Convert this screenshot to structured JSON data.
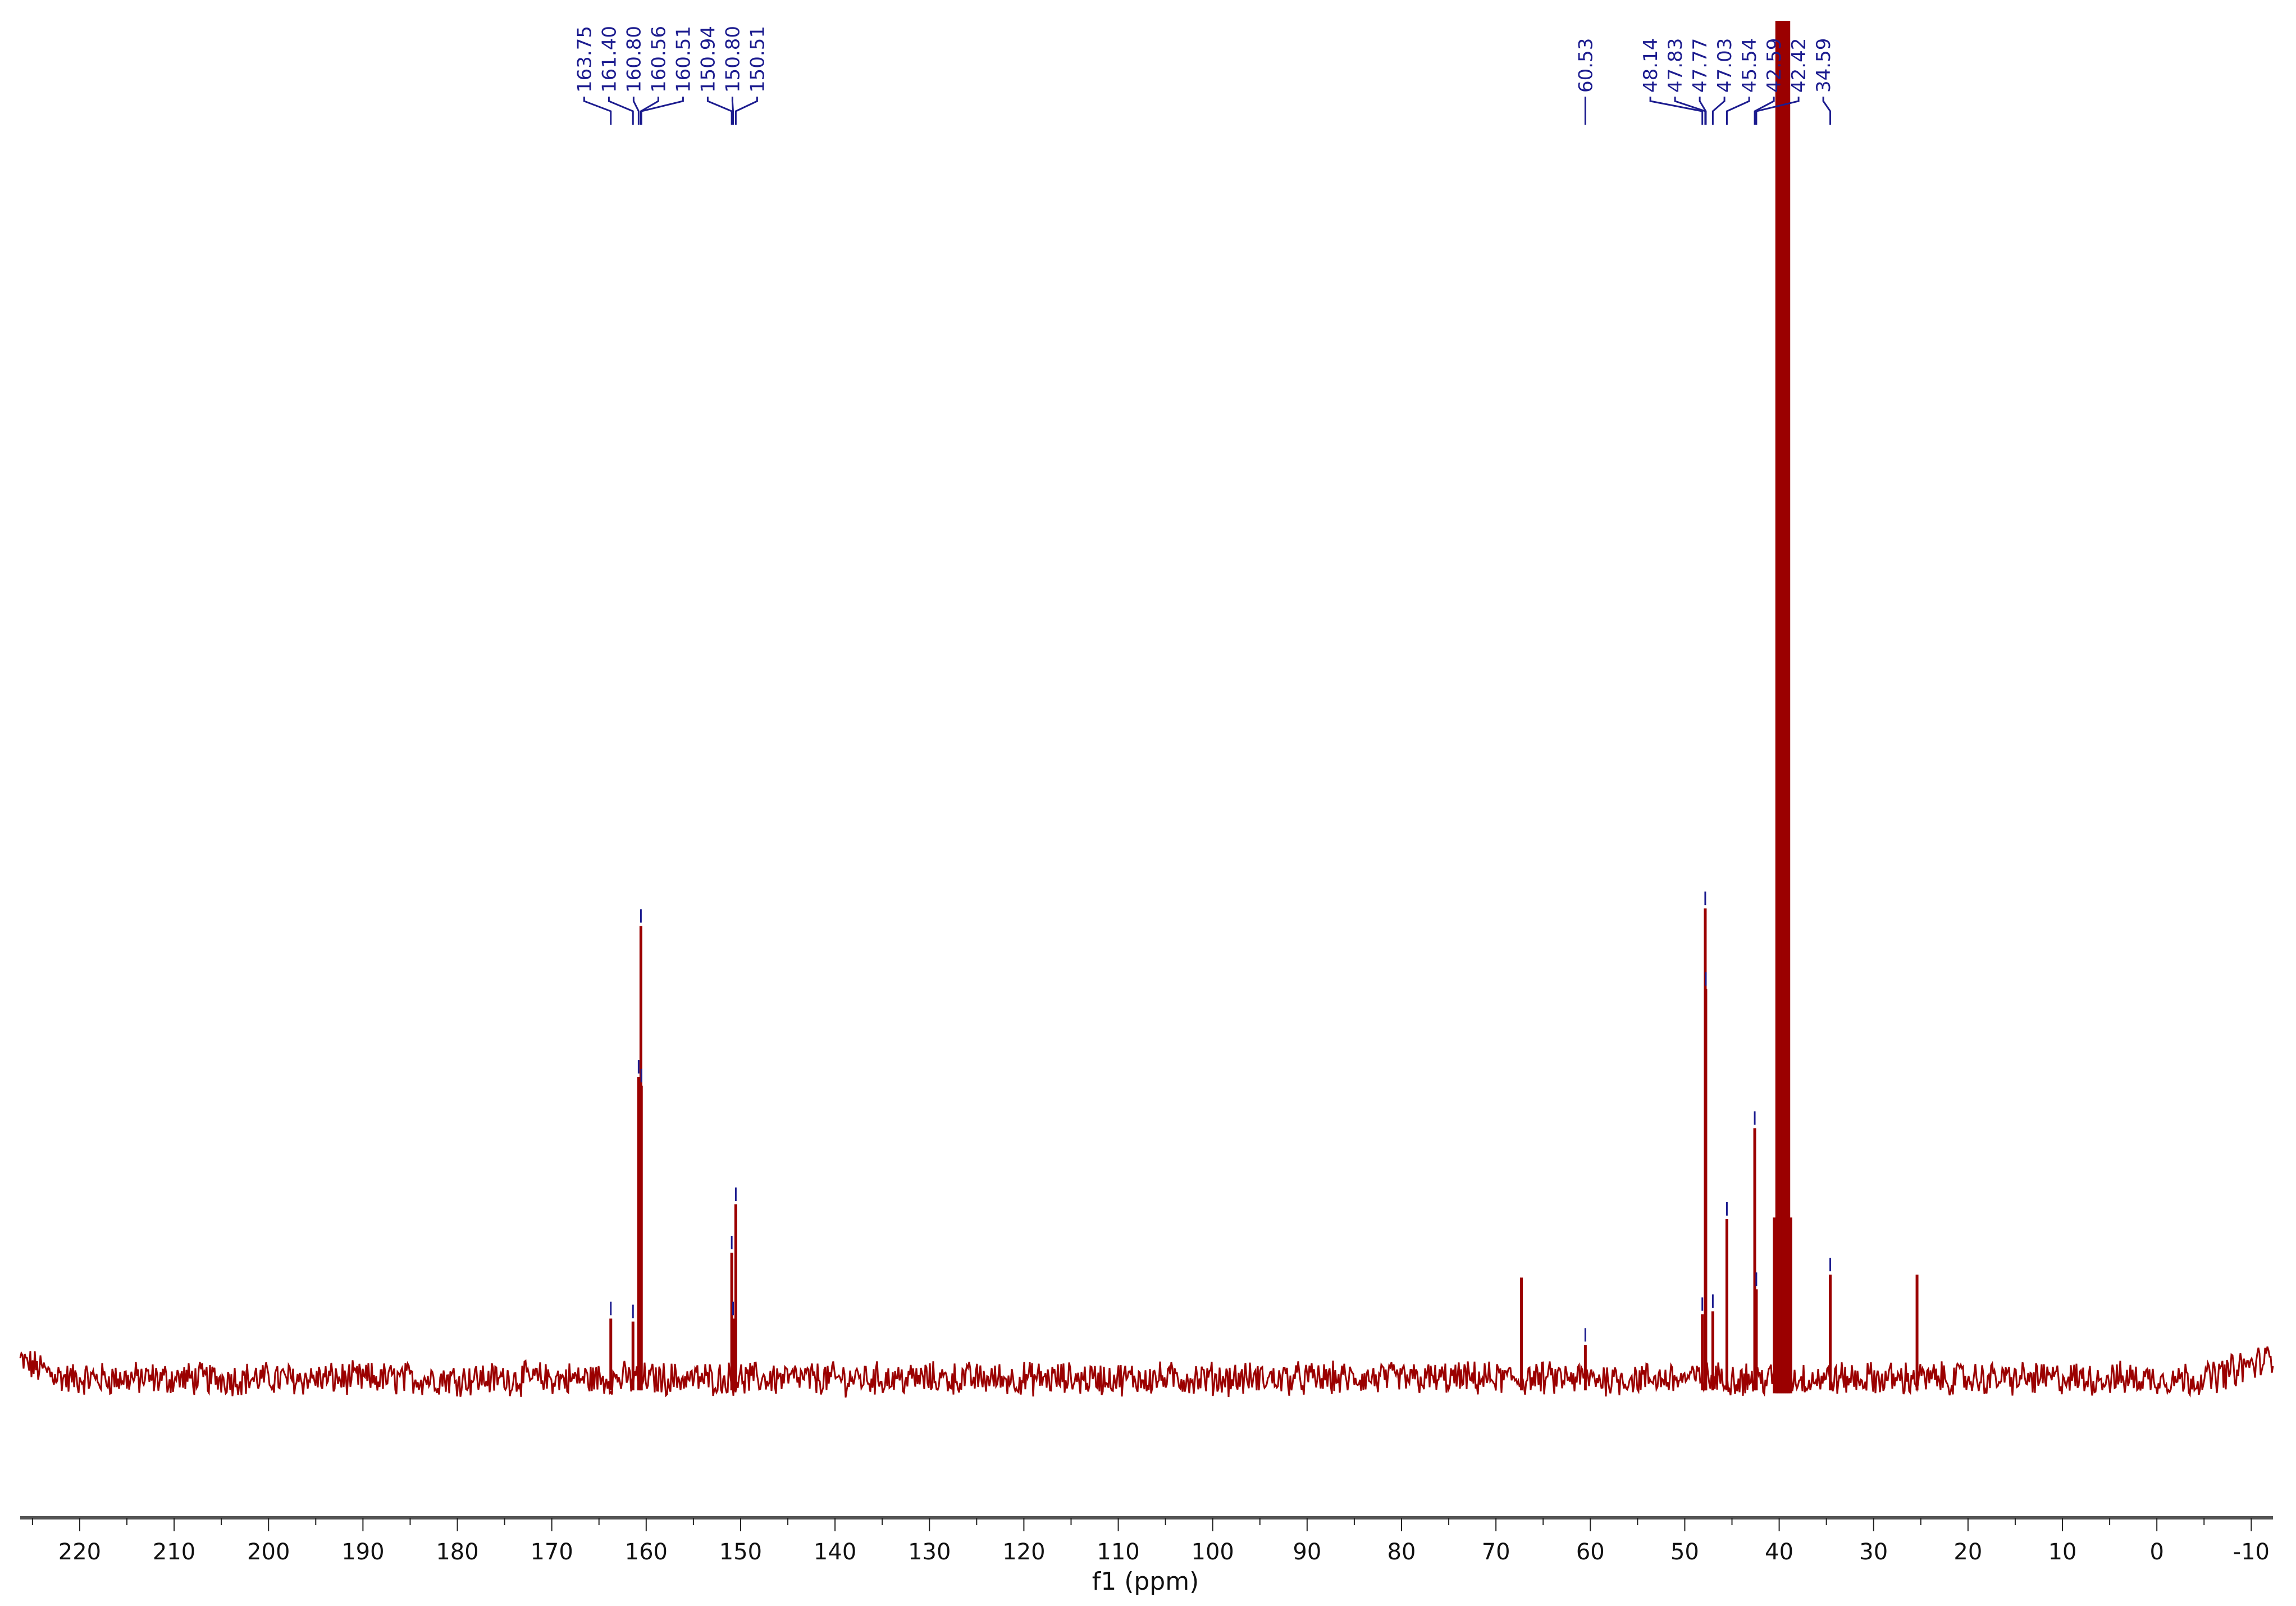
{
  "chart_data": {
    "type": "line",
    "title": "",
    "xlabel": "f1 (ppm)",
    "ylabel": "",
    "xlim": [
      226.3,
      -12.3
    ],
    "ylim": [
      -95,
      927
    ],
    "x_ticks": [
      220,
      210,
      200,
      190,
      180,
      170,
      160,
      150,
      140,
      130,
      120,
      110,
      100,
      90,
      80,
      70,
      60,
      50,
      40,
      30,
      20,
      10,
      0,
      -10
    ],
    "x_tick_labels": [
      "220",
      "210",
      "200",
      "190",
      "180",
      "170",
      "160",
      "150",
      "140",
      "130",
      "120",
      "110",
      "100",
      "90",
      "80",
      "70",
      "60",
      "50",
      "40",
      "30",
      "20",
      "10",
      "0",
      "-10"
    ],
    "minor_tick_step": 5,
    "grid": false,
    "colors": {
      "trace": "#9b0000",
      "labels": "#1c1c8f",
      "axis": "#555555"
    },
    "peaks": [
      {
        "ppm": 163.75,
        "intensity": 41,
        "label": "163.75"
      },
      {
        "ppm": 161.4,
        "intensity": 39,
        "label": "161.40"
      },
      {
        "ppm": 160.8,
        "intensity": 206,
        "label": "160.80"
      },
      {
        "ppm": 160.56,
        "intensity": 309,
        "label": "160.56"
      },
      {
        "ppm": 160.51,
        "intensity": 200,
        "label": "160.51"
      },
      {
        "ppm": 150.94,
        "intensity": 86,
        "label": "150.94"
      },
      {
        "ppm": 150.8,
        "intensity": 41,
        "label": "150.80"
      },
      {
        "ppm": 150.51,
        "intensity": 119,
        "label": "150.51"
      },
      {
        "ppm": 67.3,
        "intensity": 69,
        "label": null
      },
      {
        "ppm": 60.53,
        "intensity": 23,
        "label": "60.53"
      },
      {
        "ppm": 48.14,
        "intensity": 44,
        "label": "48.14"
      },
      {
        "ppm": 47.83,
        "intensity": 321,
        "label": "47.83"
      },
      {
        "ppm": 47.77,
        "intensity": 266,
        "label": "47.77"
      },
      {
        "ppm": 47.03,
        "intensity": 46,
        "label": "47.03"
      },
      {
        "ppm": 45.54,
        "intensity": 109,
        "label": "45.54"
      },
      {
        "ppm": 42.59,
        "intensity": 171,
        "label": "42.59"
      },
      {
        "ppm": 42.42,
        "intensity": 61,
        "label": "42.42"
      },
      {
        "ppm": 34.59,
        "intensity": 71,
        "label": "34.59"
      },
      {
        "ppm": 25.4,
        "intensity": 71,
        "label": null
      }
    ],
    "solvent_multiplet": [
      {
        "ppm": 40.4,
        "intensity": 110
      },
      {
        "ppm": 40.14,
        "intensity": 927
      },
      {
        "ppm": 39.93,
        "intensity": 927
      },
      {
        "ppm": 39.73,
        "intensity": 927
      },
      {
        "ppm": 39.52,
        "intensity": 927
      },
      {
        "ppm": 39.31,
        "intensity": 927
      },
      {
        "ppm": 39.1,
        "intensity": 927
      },
      {
        "ppm": 38.89,
        "intensity": 110
      }
    ],
    "label_groups": [
      [
        "163.75",
        "161.40",
        "160.80",
        "160.56",
        "160.51",
        "150.94",
        "150.80",
        "150.51"
      ],
      [
        "60.53"
      ],
      [
        "48.14",
        "47.83",
        "47.77",
        "47.03",
        "45.54",
        "42.59",
        "42.42",
        "34.59"
      ]
    ],
    "noise_amplitude": 10
  }
}
